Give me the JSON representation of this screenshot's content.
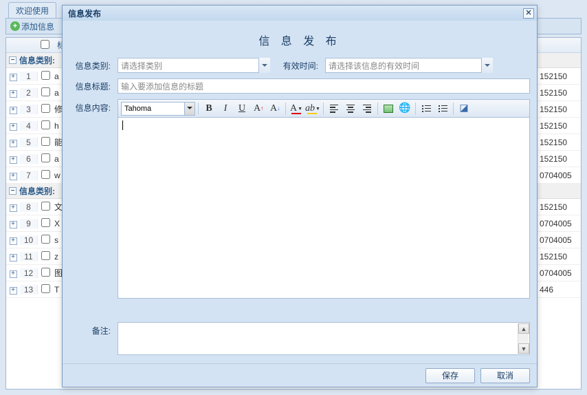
{
  "bg": {
    "tabs": [
      "欢迎使用"
    ],
    "add_label": "添加信息",
    "header_title": "标",
    "group1": "信息类别:",
    "group2": "信息类别:",
    "rows1": [
      {
        "num": "1",
        "title": "a",
        "right": "152150"
      },
      {
        "num": "2",
        "title": "a",
        "right": "152150"
      },
      {
        "num": "3",
        "title": "修",
        "right": "152150"
      },
      {
        "num": "4",
        "title": "h",
        "right": "152150"
      },
      {
        "num": "5",
        "title": "能",
        "right": "152150"
      },
      {
        "num": "6",
        "title": "a",
        "right": "152150"
      },
      {
        "num": "7",
        "title": "w",
        "right": "0704005"
      }
    ],
    "rows2": [
      {
        "num": "8",
        "title": "文",
        "right": "152150"
      },
      {
        "num": "9",
        "title": "X",
        "right": "0704005"
      },
      {
        "num": "10",
        "title": "s",
        "right": "0704005"
      },
      {
        "num": "11",
        "title": "z",
        "right": "152150"
      },
      {
        "num": "12",
        "title": "图",
        "right": "0704005"
      },
      {
        "num": "13",
        "title": "T",
        "right": "446"
      }
    ]
  },
  "modal": {
    "title": "信息发布",
    "heading": "信 息 发 布",
    "labels": {
      "category": "信息类别:",
      "valid_time": "有效时间:",
      "info_title": "信息标题:",
      "content": "信息内容:",
      "remark": "备注:"
    },
    "placeholders": {
      "category": "请选择类别",
      "valid_time": "请选择该信息的有效时间",
      "info_title": "输入要添加信息的标题"
    },
    "editor": {
      "font": "Tahoma"
    },
    "buttons": {
      "save": "保存",
      "cancel": "取消"
    }
  }
}
